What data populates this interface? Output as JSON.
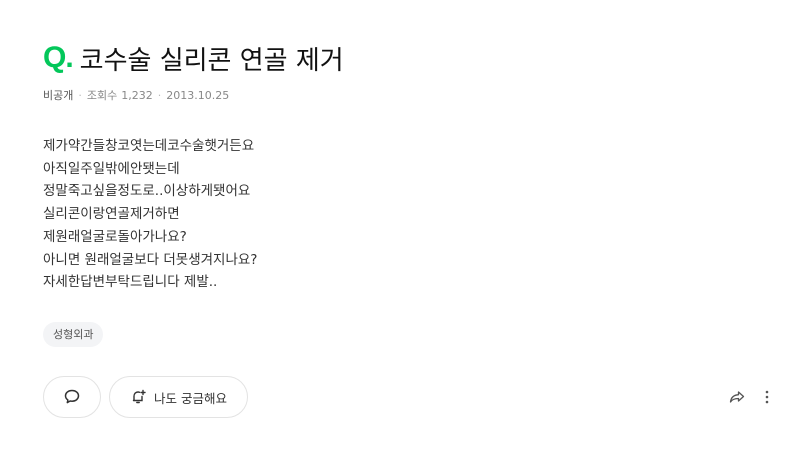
{
  "question": {
    "q_mark": "Q.",
    "title": "코수술 실리콘 연골 제거",
    "meta": {
      "visibility": "비공개",
      "views_label": "조회수",
      "views": "1,232",
      "date": "2013.10.25"
    },
    "body_lines": [
      "제가약간들창코엿는데코수술햇거든요",
      "아직일주일밖에안됏는데",
      "정말죽고싶을정도로..이상하게됏어요",
      "실리콘이랑연골제거하면",
      "제원래얼굴로돌아가나요?",
      "아니면 원래얼굴보다 더못생겨지나요?",
      "자세한답변부탁드립니다 제발.."
    ],
    "tags": [
      "성형외과"
    ]
  },
  "actions": {
    "comment_icon": "speech-bubble-icon",
    "curious_icon": "bell-plus-icon",
    "curious_label": "나도 궁금해요",
    "share_icon": "share-arrow-icon",
    "more_icon": "more-vertical-icon"
  },
  "colors": {
    "accent": "#03c75a",
    "text": "#222222",
    "muted": "#888888"
  }
}
